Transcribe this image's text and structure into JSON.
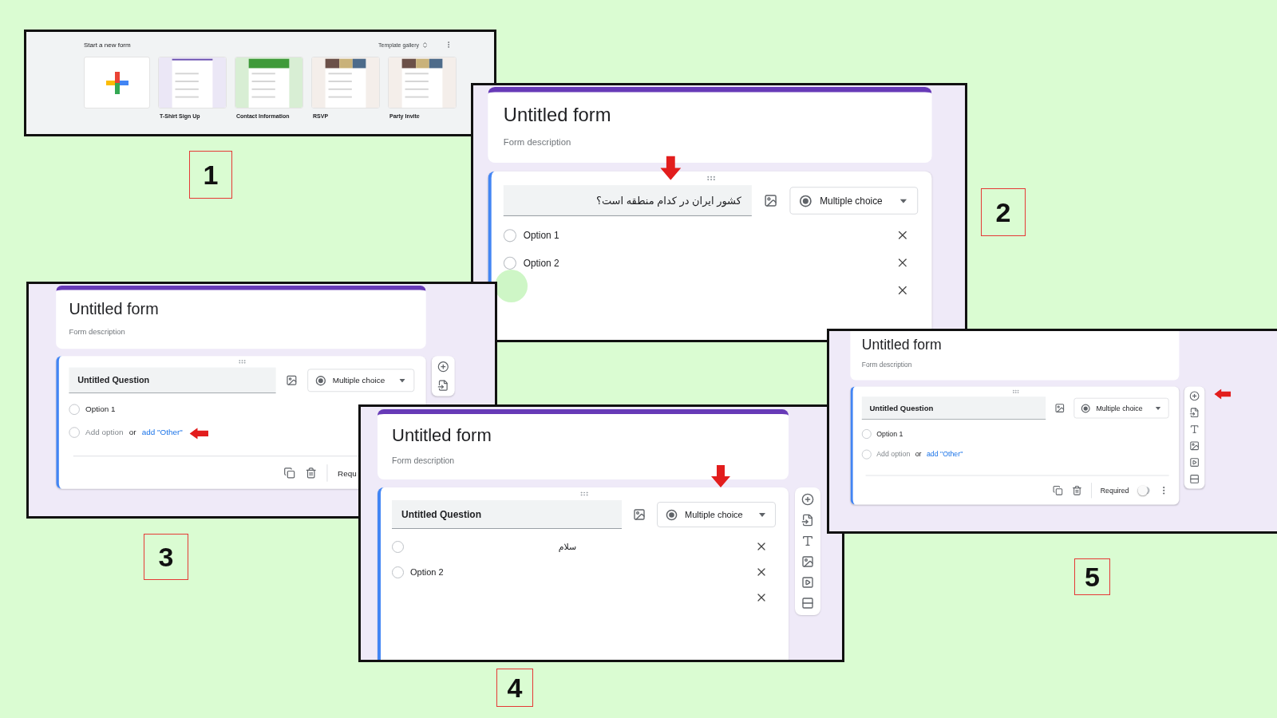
{
  "panels": [
    {
      "kind": "gallery",
      "step": "1",
      "heading": "Start a new form",
      "gallery_button": "Template gallery",
      "templates": [
        {
          "kind": "blank"
        },
        {
          "kind": "plain",
          "label": "T-Shirt Sign Up"
        },
        {
          "kind": "green",
          "label": "Contact Information"
        },
        {
          "kind": "photo",
          "label": "RSVP"
        },
        {
          "kind": "photo",
          "label": "Party Invite"
        }
      ]
    },
    {
      "kind": "editor",
      "step": "2",
      "form_title": "Untitled form",
      "description": "Form description",
      "question": "کشور ایران در کدام منطقه است؟",
      "question_rtl": true,
      "question_type": "Multiple choice",
      "options": [
        {
          "kind": "option",
          "label": "Option 1",
          "checked": false,
          "removable": true
        },
        {
          "kind": "option",
          "label": "Option 2",
          "checked": false,
          "removable": true
        },
        {
          "kind": "blank",
          "removable": true
        }
      ],
      "click_marker": true,
      "pointer": {
        "kind": "question"
      }
    },
    {
      "kind": "editor",
      "step": "3",
      "form_title": "Untitled form",
      "description": "Form description",
      "question": "Untitled Question",
      "question_type": "Multiple choice",
      "options": [
        {
          "kind": "option",
          "label": "Option 1",
          "checked": false,
          "removable": false
        }
      ],
      "add_option": {
        "label": "Add option",
        "or": "or",
        "link": "add \"Other\"",
        "checked": false
      },
      "tools": [
        {
          "kind": "add"
        },
        {
          "kind": "import"
        }
      ],
      "footer": {
        "required_label": "Requ"
      },
      "pointer": {
        "kind": "other"
      }
    },
    {
      "kind": "editor",
      "step": "4",
      "form_title": "Untitled form",
      "description": "Form description",
      "question": "Untitled Question",
      "question_type": "Multiple choice",
      "options": [
        {
          "kind": "option",
          "label": "سلام",
          "rtl": true,
          "checked": false,
          "removable": true
        },
        {
          "kind": "option",
          "label": "Option 2",
          "checked": false,
          "removable": true
        },
        {
          "kind": "blank",
          "removable": true
        }
      ],
      "tools": [
        {
          "kind": "add"
        },
        {
          "kind": "import"
        },
        {
          "kind": "title"
        },
        {
          "kind": "image"
        },
        {
          "kind": "video"
        },
        {
          "kind": "section"
        }
      ],
      "pointer": {
        "kind": "type"
      }
    },
    {
      "kind": "editor",
      "step": "5",
      "form_title": "Untitled form",
      "description": "Form description",
      "question": "Untitled Question",
      "question_type": "Multiple choice",
      "options": [
        {
          "kind": "option",
          "label": "Option 1",
          "checked": false,
          "removable": false
        }
      ],
      "add_option": {
        "label": "Add option",
        "or": "or",
        "link": "add \"Other\"",
        "checked": false
      },
      "tools": [
        {
          "kind": "add"
        },
        {
          "kind": "import"
        },
        {
          "kind": "title"
        },
        {
          "kind": "image"
        },
        {
          "kind": "video"
        },
        {
          "kind": "section"
        }
      ],
      "footer": {
        "required_label": "Required",
        "required": false
      },
      "pointer": {
        "kind": "toolbar"
      }
    }
  ]
}
